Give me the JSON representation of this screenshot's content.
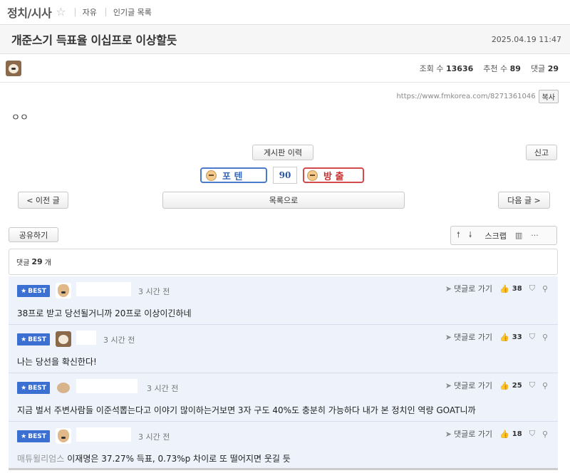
{
  "board": {
    "title": "정치/시사",
    "links": [
      "자유",
      "인기글 목록"
    ]
  },
  "post": {
    "title": "개준스기 득표율 이십프로 이상할듯",
    "date": "2025.04.19 11:47",
    "stats": {
      "views_label": "조회 수",
      "views": "13636",
      "recommend_label": "추천 수",
      "recommend": "89",
      "comments_label": "댓글",
      "comments": "29"
    },
    "url": "https://www.fmkorea.com/8271361046",
    "copy_label": "복사",
    "body": "ㅇㅇ"
  },
  "buttons": {
    "history": "게시판 이력",
    "report": "신고",
    "prev": "< 이전 글",
    "list": "목록으로",
    "next": "다음 글 >",
    "share": "공유하기",
    "scrap": "스크랩"
  },
  "vote": {
    "up_label": "포 텐",
    "count": "90",
    "down_label": "방 출"
  },
  "comment_header": {
    "prefix": "댓글",
    "count": "29",
    "suffix": "개"
  },
  "best_label": "BEST",
  "goto_label": "댓글로 가기",
  "comments": [
    {
      "time": "3 시간 전",
      "likes": "38",
      "text": "38프로 받고 당선될거니까 20프로 이상이긴하네",
      "mention": ""
    },
    {
      "time": "3 시간 전",
      "likes": "33",
      "text": "나는 당선을 확신한다!",
      "mention": ""
    },
    {
      "time": "3 시간 전",
      "likes": "25",
      "text": "지금 벌서 주변사람들 이준석뽑는다고 이야기 많이하는거보면 3자 구도 40%도 충분히 가능하다 내가 본 정치인 역량 GOAT니까",
      "mention": ""
    },
    {
      "time": "3 시간 전",
      "likes": "18",
      "text": "이재명은 37.27% 득표, 0.73%p 차이로 또 떨어지면 웃길 듯",
      "mention": "매튜윌리엄스"
    }
  ],
  "colors": {
    "best_badge": "#3b6fd1",
    "comment_bg": "#edf2fb",
    "vote_up": "#4a7ac8",
    "vote_down": "#d24a4a"
  },
  "icons": [
    "star-icon",
    "thumb-up-icon",
    "thumb-down-icon",
    "link-icon",
    "arrow-up-icon",
    "arrow-down-icon",
    "chart-icon",
    "more-icon",
    "send-icon"
  ]
}
